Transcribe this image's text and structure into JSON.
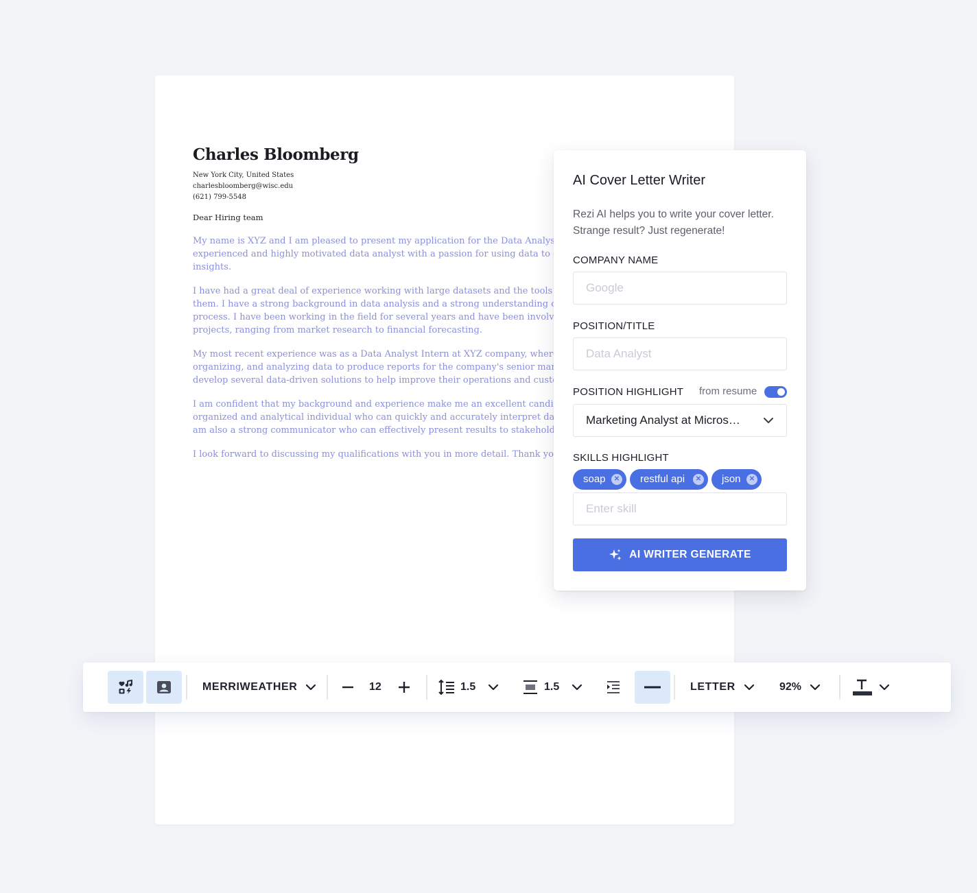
{
  "document": {
    "name": "Charles Bloomberg",
    "location": "New York City, United States",
    "email": "charlesbloomberg@wisc.edu",
    "phone": "(621) 799-5548",
    "greeting": "Dear Hiring team",
    "paragraphs": [
      [
        "My name is XYZ and I am pleased to present my application for the Data Analyst po",
        "experienced and highly motivated data analyst with a passion for using data to driv",
        "insights."
      ],
      [
        "I have had a great deal of experience working with large datasets and the tools need",
        "them. I have a strong background in data analysis and a strong understanding of th",
        "process. I have been working in the field for several years and have been involved ir",
        "projects, ranging from market research to financial forecasting."
      ],
      [
        "My most recent experience was as a Data Analyst Intern at XYZ company, where I w",
        "organizing, and analyzing data to produce reports for the company's senior manag",
        "develop several data-driven solutions to help improve their operations and custom"
      ],
      [
        "I am confident that my background and experience make me an excellent candidate",
        "organized and analytical individual who can quickly and accurately interpret data a",
        "am also a strong communicator who can effectively present results to stakeholders"
      ],
      [
        "I look forward to discussing my qualifications with you in more detail. Thank you fo"
      ]
    ]
  },
  "ai_panel": {
    "title": "AI Cover Letter Writer",
    "description": "Rezi AI helps you to write your cover letter. Strange result? Just regenerate!",
    "company_label": "COMPANY NAME",
    "company_placeholder": "Google",
    "position_label": "POSITION/TITLE",
    "position_placeholder": "Data Analyst",
    "highlight_label": "POSITION HIGHLIGHT",
    "from_resume_label": "from resume",
    "from_resume_on": true,
    "highlight_value": "Marketing Analyst at Micros…",
    "skills_label": "SKILLS HIGHLIGHT",
    "skills": [
      "soap",
      "restful api",
      "json"
    ],
    "skill_placeholder": "Enter skill",
    "generate_label": "AI WRITER GENERATE",
    "accent_color": "#4a6fe3"
  },
  "toolbar": {
    "icons": [
      "design-icon",
      "profile-photo-icon"
    ],
    "font": "MERRIWEATHER",
    "font_size": "12",
    "line_spacing": "1.5",
    "paragraph_spacing": "1.5",
    "page_size": "LETTER",
    "zoom": "92%",
    "active_button_bg": "#dce9fb"
  }
}
